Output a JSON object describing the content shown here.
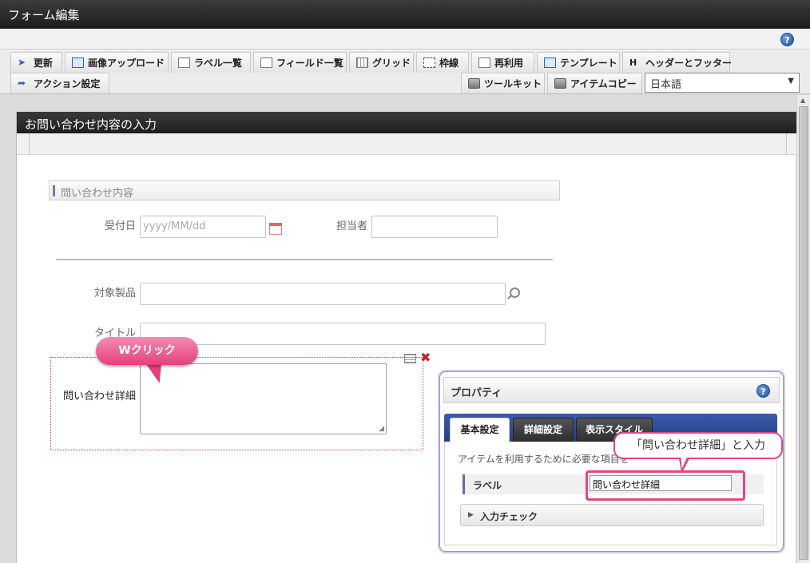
{
  "app": {
    "title": "フォーム編集"
  },
  "toolbar": {
    "row1": [
      {
        "label": "更新",
        "icon": "refresh-icon"
      },
      {
        "label": "画像アップロード",
        "icon": "image-upload-icon"
      },
      {
        "label": "ラベル一覧",
        "icon": "label-list-icon"
      },
      {
        "label": "フィールド一覧",
        "icon": "field-list-icon"
      },
      {
        "label": "グリッド",
        "icon": "grid-icon"
      },
      {
        "label": "枠線",
        "icon": "border-icon"
      },
      {
        "label": "再利用",
        "icon": "reuse-icon"
      },
      {
        "label": "テンプレート",
        "icon": "template-icon"
      },
      {
        "label": "ヘッダーとフッター",
        "icon": "header-footer-icon"
      }
    ],
    "row2": [
      {
        "label": "アクション設定",
        "icon": "action-icon"
      },
      {
        "label": "ツールキット",
        "icon": "toolkit-icon"
      },
      {
        "label": "アイテムコピー",
        "icon": "item-copy-icon"
      }
    ],
    "language": "日本語"
  },
  "form": {
    "header": "お問い合わせ内容の入力",
    "section_title": "問い合わせ内容",
    "fields": {
      "received_date_label": "受付日",
      "received_date_placeholder": "yyyy/MM/dd",
      "assignee_label": "担当者",
      "product_label": "対象製品",
      "title_label": "タイトル",
      "details_label": "問い合わせ詳細"
    }
  },
  "callouts": {
    "double_click": "Wクリック",
    "enter_label": "「問い合わせ詳細」と入力"
  },
  "properties": {
    "title": "プロパティ",
    "tabs": [
      "基本設定",
      "詳細設定",
      "表示スタイル"
    ],
    "description": "アイテムを利用するために必要な項目を",
    "label_name": "ラベル",
    "label_value": "問い合わせ詳細",
    "input_check": "入力チェック"
  },
  "colors": {
    "accent_pink": "#e24585",
    "tab_blue": "#2d4b98",
    "header_dark": "#2a2a2a"
  }
}
